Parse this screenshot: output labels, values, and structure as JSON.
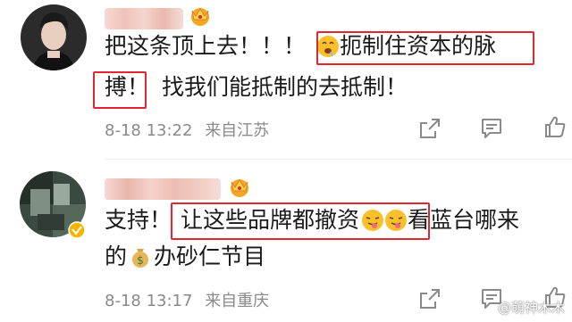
{
  "comments": [
    {
      "line1_a": "把这条顶上去！！！",
      "line1_b": "扼制住资本的脉",
      "line2_a": "搏！",
      "line2_b": "找我们能抵制的去抵制！",
      "date": "8-18 13:22",
      "location": "来自江苏",
      "icons": [
        "share-icon",
        "comment-icon",
        "like-icon"
      ]
    },
    {
      "line1_a": "支持！",
      "line1_b": "让这些品牌都撤资",
      "line1_c": "看蓝台哪来",
      "line2_a": "的",
      "line2_b": "办砂仁节目",
      "date": "8-18 13:17",
      "location": "来自重庆",
      "icons": [
        "share-icon",
        "comment-icon",
        "like-icon"
      ]
    }
  ],
  "watermark": "@萌神木木",
  "colors": {
    "highlight": "#e0262f",
    "text": "#1a1a1a",
    "meta": "#8a8a8a",
    "username_blur": "#f2c7c7"
  }
}
